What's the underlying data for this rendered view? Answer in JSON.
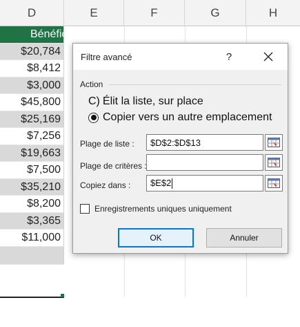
{
  "spreadsheet": {
    "columns": [
      "D",
      "E",
      "F",
      "G",
      "H"
    ],
    "column_d": {
      "header": "Bénéfice",
      "values": [
        "$20,784",
        "$8,412",
        "$3,000",
        "$45,800",
        "$25,169",
        "$7,256",
        "$19,663",
        "$7,500",
        "$35,210",
        "$8,200",
        "$3,365",
        "$11,000",
        ""
      ]
    },
    "colors": {
      "header_green": "#217346",
      "row_gray": "#d9d9d9"
    }
  },
  "dialog": {
    "title": "Filtre avancé",
    "help_label": "?",
    "close_icon": "close-icon",
    "action_group_label": "Action",
    "option_in_place_prefix": "C)",
    "option_in_place_label": "Élit la liste, sur place",
    "option_copy_label": "Copier vers un autre emplacement",
    "selected_option": "copy",
    "list_range_label": "Plage de liste :",
    "list_range_value": "$D$2:$D$13",
    "criteria_range_label": "Plage de critères :",
    "criteria_range_value": "",
    "copy_to_label": "Copiez dans :",
    "copy_to_value": "$E$2",
    "unique_records_label": "Enregistrements uniques uniquement",
    "unique_records_checked": false,
    "ok_label": "OK",
    "cancel_label": "Annuler",
    "accent_color": "#0078d7"
  }
}
